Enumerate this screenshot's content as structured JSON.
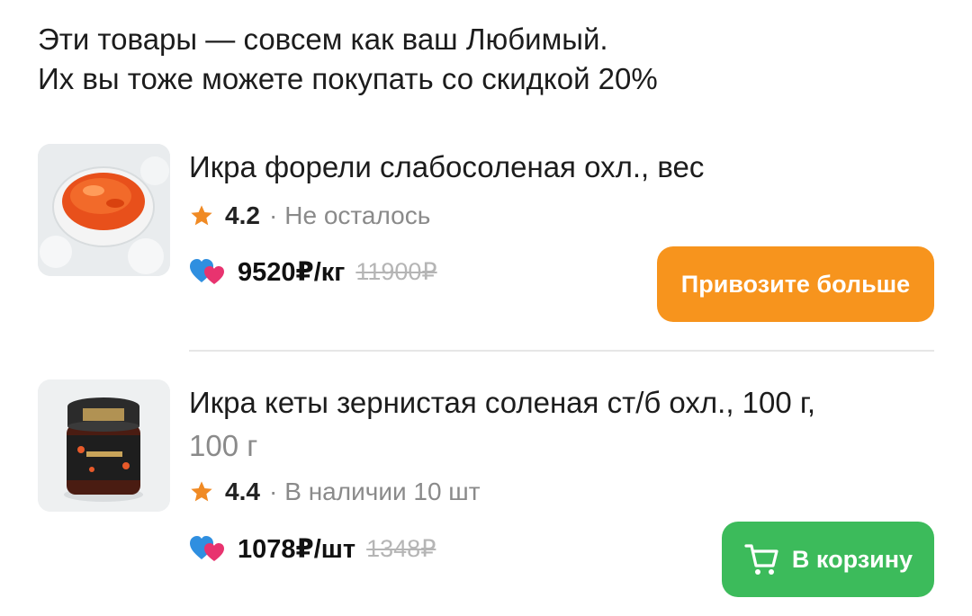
{
  "header": {
    "line1": "Эти товары — совсем как ваш Любимый.",
    "line2": "Их вы тоже можете покупать со скидкой 20%"
  },
  "products": [
    {
      "title": "Икра форели слабосоленая охл., вес",
      "weight": "",
      "rating": "4.2",
      "stock": "Не осталось",
      "price": "9520₽/кг",
      "old_price": "11900₽",
      "button_label": "Привозите больше",
      "button_color": "#f7941d"
    },
    {
      "title": "Икра кеты зернистая соленая ст/б охл., 100 г,",
      "weight": "100 г",
      "rating": "4.4",
      "stock": "В наличии 10 шт",
      "price": "1078₽/шт",
      "old_price": "1348₽",
      "button_label": "В корзину",
      "button_color": "#3cbb5b"
    }
  ],
  "icons": {
    "rating": "star-icon",
    "loyalty": "hearts-icon",
    "cart": "cart-icon"
  },
  "colors": {
    "star": "#f08a24",
    "heart_blue": "#2f8fe0",
    "heart_pink": "#e8336f"
  }
}
